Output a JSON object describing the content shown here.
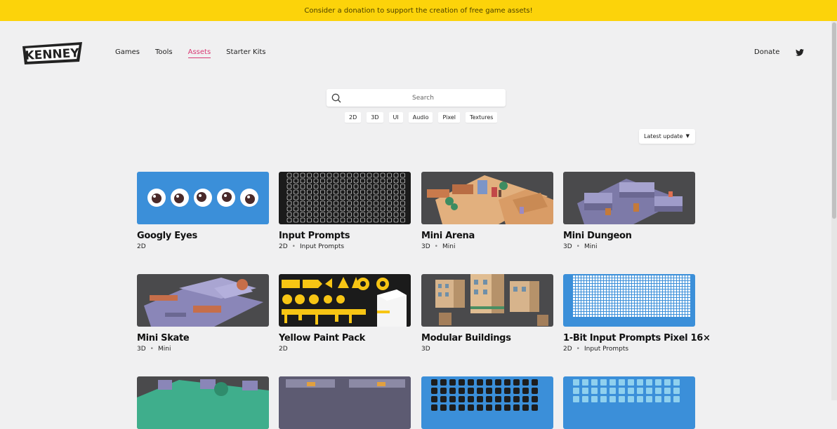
{
  "banner": {
    "text": "Consider a donation to support the creation of free game assets!"
  },
  "logo": {
    "text": "KENNEY"
  },
  "nav": [
    {
      "label": "Games",
      "active": false
    },
    {
      "label": "Tools",
      "active": false
    },
    {
      "label": "Assets",
      "active": true
    },
    {
      "label": "Starter Kits",
      "active": false
    }
  ],
  "header": {
    "donate_label": "Donate",
    "twitter_icon": "twitter-icon"
  },
  "search": {
    "placeholder": "Search"
  },
  "filters": [
    "2D",
    "3D",
    "UI",
    "Audio",
    "Pixel",
    "Textures"
  ],
  "sort": {
    "selected": "Latest update"
  },
  "colors": {
    "banner": "#fcd30a",
    "accent": "#d93a74",
    "background": "#f0f0f1"
  },
  "cards": [
    {
      "title": "Googly Eyes",
      "type": "2D",
      "tag": ""
    },
    {
      "title": "Input Prompts",
      "type": "2D",
      "tag": "Input Prompts"
    },
    {
      "title": "Mini Arena",
      "type": "3D",
      "tag": "Mini"
    },
    {
      "title": "Mini Dungeon",
      "type": "3D",
      "tag": "Mini"
    },
    {
      "title": "Mini Skate",
      "type": "3D",
      "tag": "Mini"
    },
    {
      "title": "Yellow Paint Pack",
      "type": "2D",
      "tag": ""
    },
    {
      "title": "Modular Buildings",
      "type": "3D",
      "tag": ""
    },
    {
      "title": "1-Bit Input Prompts Pixel 16×",
      "type": "2D",
      "tag": "Input Prompts"
    }
  ]
}
